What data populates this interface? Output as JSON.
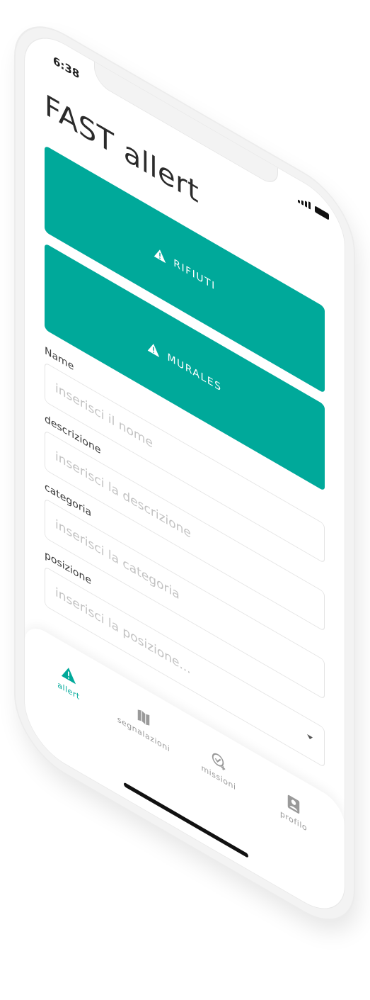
{
  "status_bar": {
    "time": "6:38"
  },
  "header": {
    "title": "FAST allert"
  },
  "actions": [
    {
      "label": "RIFIUTI",
      "icon": "warning-icon"
    },
    {
      "label": "MURALES",
      "icon": "warning-icon"
    }
  ],
  "form": {
    "name": {
      "label": "Name",
      "placeholder": "inserisci il nome",
      "value": ""
    },
    "descrizione": {
      "label": "descrizione",
      "placeholder": "inserisci la descrizione",
      "value": ""
    },
    "categoria": {
      "label": "categoria",
      "placeholder": "inserisci la categoria",
      "value": ""
    },
    "posizione": {
      "label": "posizione",
      "placeholder": "inserisci la posizione...",
      "value": ""
    }
  },
  "tabbar": {
    "active": "allert",
    "items": [
      {
        "label": "allert",
        "icon": "warning-icon"
      },
      {
        "label": "segnalazioni",
        "icon": "map-icon"
      },
      {
        "label": "missioni",
        "icon": "check-plus-icon"
      },
      {
        "label": "profilo",
        "icon": "profile-icon"
      }
    ]
  },
  "colors": {
    "accent": "#00a99a",
    "inactive": "#9a9a9a",
    "placeholder": "#c3c3c3"
  }
}
